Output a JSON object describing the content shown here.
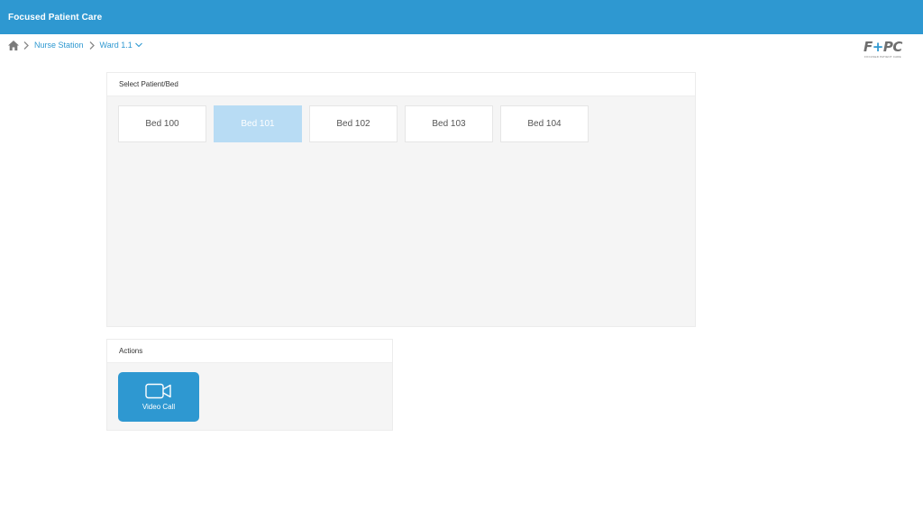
{
  "header": {
    "app_title": "Focused Patient Care"
  },
  "breadcrumb": {
    "home_icon": "home-icon",
    "items": [
      {
        "label": "Nurse Station"
      },
      {
        "label": "Ward 1.1"
      }
    ],
    "separator_icon": "chevron-right-icon",
    "dropdown_icon": "chevron-down-icon"
  },
  "logo": {
    "text_a": "F",
    "text_plus": "+",
    "text_b": "PC",
    "subtitle": "FOCUSED PATIENT CARE"
  },
  "beds_panel": {
    "title": "Select Patient/Bed",
    "beds": [
      {
        "label": "Bed 100",
        "selected": false
      },
      {
        "label": "Bed 101",
        "selected": true
      },
      {
        "label": "Bed 102",
        "selected": false
      },
      {
        "label": "Bed 103",
        "selected": false
      },
      {
        "label": "Bed 104",
        "selected": false
      }
    ]
  },
  "actions_panel": {
    "title": "Actions",
    "actions": [
      {
        "label": "Video Call",
        "icon": "video-camera-icon"
      }
    ]
  },
  "colors": {
    "primary": "#2e98d1",
    "selected_bed": "#b8dcf4",
    "panel_bg": "#f5f5f5"
  }
}
